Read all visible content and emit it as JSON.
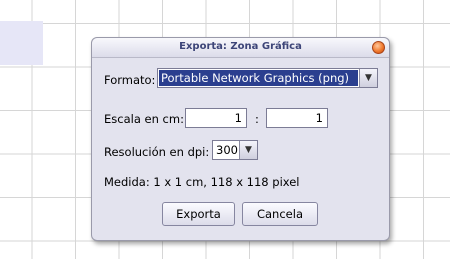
{
  "dialog": {
    "title": "Exporta: Zona Gráfica",
    "format_label": "Formato:",
    "format_value": "Portable Network Graphics (png)",
    "scale_label": "Escala en cm:",
    "scale_left": "1",
    "scale_separator": ":",
    "scale_right": "1",
    "resolution_label": "Resolución en dpi:",
    "resolution_value": "300",
    "measure_text": "Medida:  1 x 1 cm, 118 x 118 pixel",
    "export_button": "Exporta",
    "cancel_button": "Cancela",
    "dropdown_arrow": "▼"
  },
  "colors": {
    "title_text": "#3d4578",
    "selection": "#2b3f8f",
    "close_button": "#f07a2f"
  }
}
